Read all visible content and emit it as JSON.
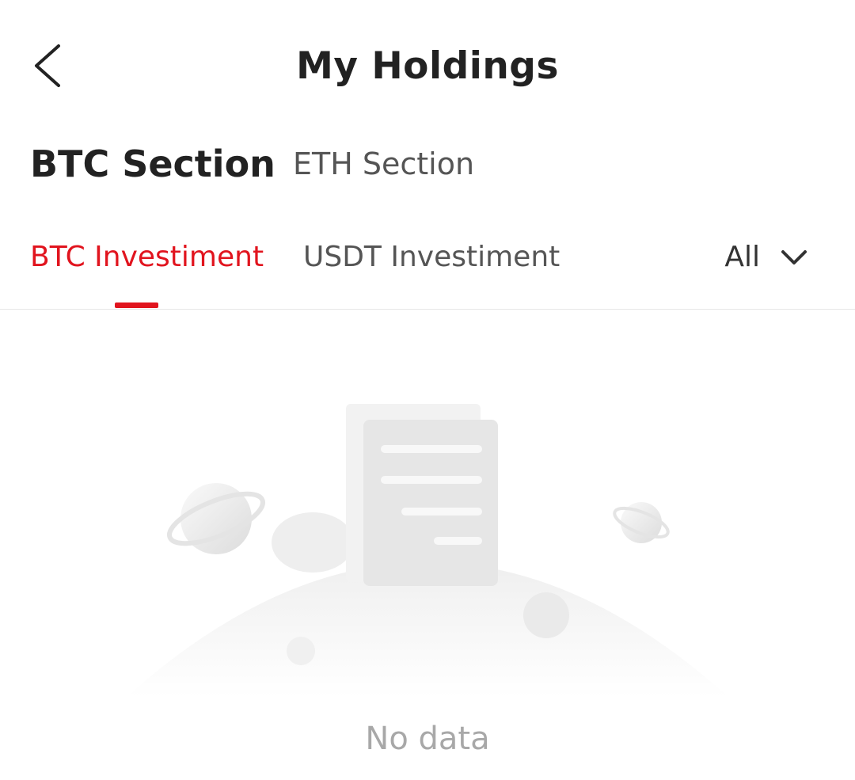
{
  "header": {
    "title": "My Holdings",
    "back_icon": "chevron-left-icon"
  },
  "sections": {
    "active": "BTC Section",
    "inactive": "ETH Section"
  },
  "subtabs": {
    "active": "BTC Investiment",
    "inactive": "USDT Investiment",
    "filter_value": "All",
    "filter_icon": "chevron-down-icon"
  },
  "empty_state": {
    "message": "No data",
    "illustration": "empty-document-planet-illustration"
  },
  "colors": {
    "accent": "#e1141e",
    "text": "#222222",
    "muted": "#a8a8a8"
  }
}
